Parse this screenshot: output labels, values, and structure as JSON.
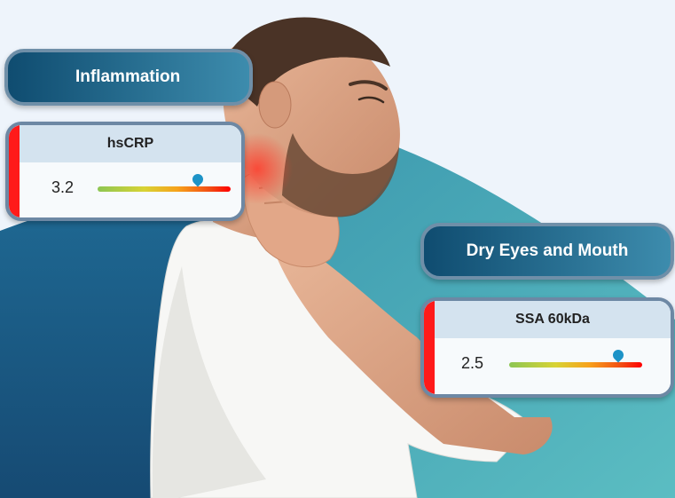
{
  "inflammation": {
    "heading": "Inflammation",
    "marker": {
      "name": "hsCRP",
      "value": "3.2",
      "level_fraction": 0.75
    }
  },
  "dry_eyes": {
    "heading": "Dry Eyes and Mouth",
    "marker": {
      "name": "SSA 60kDa",
      "value": "2.5",
      "level_fraction": 0.82
    }
  },
  "colors": {
    "teal_backdrop": "#3f9fb4",
    "navy_backdrop": "#1b5a86",
    "pill_dark": "#0f4c70",
    "pill_light": "#3d8cad",
    "alert_stripe": "#ff1a1a",
    "marker_pin": "#1d93c7"
  },
  "icons": {
    "marker_pin": "map-pin-icon"
  }
}
